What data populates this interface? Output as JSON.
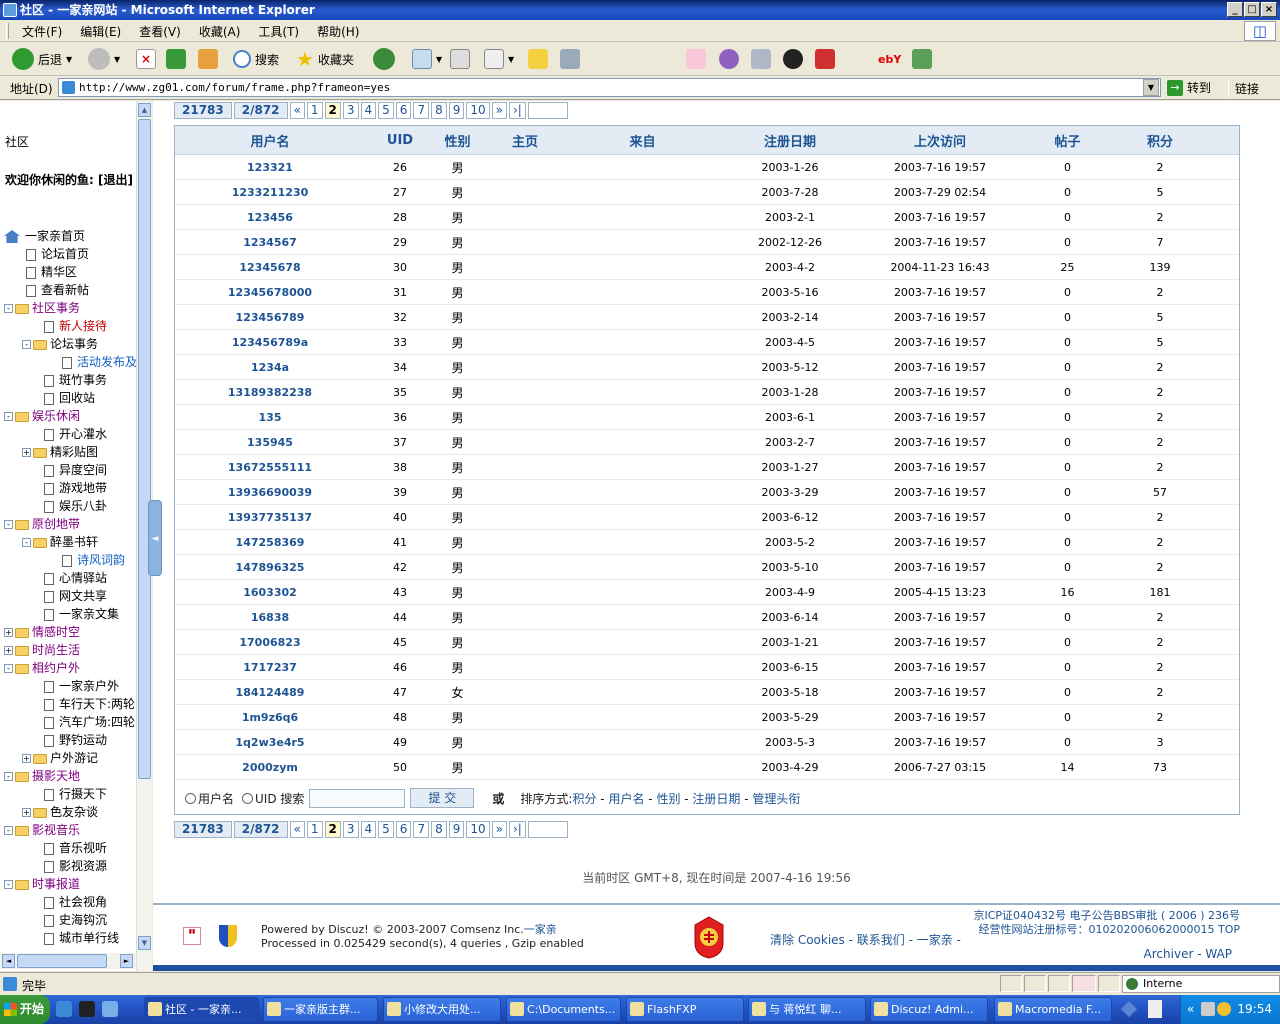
{
  "window": {
    "title": "社区 - 一家亲网站 - Microsoft Internet Explorer"
  },
  "menu": [
    "文件(F)",
    "编辑(E)",
    "查看(V)",
    "收藏(A)",
    "工具(T)",
    "帮助(H)"
  ],
  "toolbar": {
    "back": "后退",
    "search": "搜索",
    "favorites": "收藏夹"
  },
  "address": {
    "label": "地址(D)",
    "url": "http://www.zg01.com/forum/frame.php?frameon=yes",
    "go": "转到",
    "links": "链接"
  },
  "sidebar": {
    "heading": "社区",
    "welcome": "欢迎你休闲的鱼: [退出]",
    "tree": [
      {
        "label": "一家亲首页",
        "indent": 0,
        "type": "home",
        "color": ""
      },
      {
        "label": "论坛首页",
        "indent": 1,
        "type": "doc",
        "color": ""
      },
      {
        "label": "精华区",
        "indent": 1,
        "type": "doc",
        "color": ""
      },
      {
        "label": "查看新帖",
        "indent": 1,
        "type": "doc",
        "color": ""
      },
      {
        "label": "社区事务",
        "indent": 0,
        "type": "folder",
        "pm": "-",
        "color": "purp"
      },
      {
        "label": "新人接待",
        "indent": 2,
        "type": "doc",
        "color": "red"
      },
      {
        "label": "论坛事务",
        "indent": 1,
        "type": "folder",
        "pm": "-",
        "color": ""
      },
      {
        "label": "活动发布及",
        "indent": 3,
        "type": "doc",
        "color": "blue"
      },
      {
        "label": "斑竹事务",
        "indent": 2,
        "type": "doc",
        "color": ""
      },
      {
        "label": "回收站",
        "indent": 2,
        "type": "doc",
        "color": ""
      },
      {
        "label": "娱乐休闲",
        "indent": 0,
        "type": "folder",
        "pm": "-",
        "color": "purp"
      },
      {
        "label": "开心灌水",
        "indent": 2,
        "type": "doc",
        "color": ""
      },
      {
        "label": "精彩贴图",
        "indent": 1,
        "type": "folder",
        "pm": "+",
        "color": ""
      },
      {
        "label": "异度空间",
        "indent": 2,
        "type": "doc",
        "color": ""
      },
      {
        "label": "游戏地带",
        "indent": 2,
        "type": "doc",
        "color": ""
      },
      {
        "label": "娱乐八卦",
        "indent": 2,
        "type": "doc",
        "color": ""
      },
      {
        "label": "原创地带",
        "indent": 0,
        "type": "folder",
        "pm": "-",
        "color": "purp"
      },
      {
        "label": "醉墨书轩",
        "indent": 1,
        "type": "folder",
        "pm": "-",
        "color": ""
      },
      {
        "label": "诗风词韵",
        "indent": 3,
        "type": "doc",
        "color": "blue"
      },
      {
        "label": "心情驿站",
        "indent": 2,
        "type": "doc",
        "color": ""
      },
      {
        "label": "网文共享",
        "indent": 2,
        "type": "doc",
        "color": ""
      },
      {
        "label": "一家亲文集",
        "indent": 2,
        "type": "doc",
        "color": ""
      },
      {
        "label": "情感时空",
        "indent": 0,
        "type": "folder",
        "pm": "+",
        "color": "purp"
      },
      {
        "label": "时尚生活",
        "indent": 0,
        "type": "folder",
        "pm": "+",
        "color": "purp"
      },
      {
        "label": "相约户外",
        "indent": 0,
        "type": "folder",
        "pm": "-",
        "color": "purp"
      },
      {
        "label": "一家亲户外",
        "indent": 2,
        "type": "doc",
        "color": ""
      },
      {
        "label": "车行天下:两轮",
        "indent": 2,
        "type": "doc",
        "color": ""
      },
      {
        "label": "汽车广场:四轮",
        "indent": 2,
        "type": "doc",
        "color": ""
      },
      {
        "label": "野钓运动",
        "indent": 2,
        "type": "doc",
        "color": ""
      },
      {
        "label": "户外游记",
        "indent": 1,
        "type": "folder",
        "pm": "+",
        "color": ""
      },
      {
        "label": "摄影天地",
        "indent": 0,
        "type": "folder",
        "pm": "-",
        "color": "purp"
      },
      {
        "label": "行摄天下",
        "indent": 2,
        "type": "doc",
        "color": ""
      },
      {
        "label": "色友杂谈",
        "indent": 1,
        "type": "folder",
        "pm": "+",
        "color": ""
      },
      {
        "label": "影视音乐",
        "indent": 0,
        "type": "folder",
        "pm": "-",
        "color": "purp"
      },
      {
        "label": "音乐视听",
        "indent": 2,
        "type": "doc",
        "color": ""
      },
      {
        "label": "影视资源",
        "indent": 2,
        "type": "doc",
        "color": ""
      },
      {
        "label": "时事报道",
        "indent": 0,
        "type": "folder",
        "pm": "-",
        "color": "purp"
      },
      {
        "label": "社会视角",
        "indent": 2,
        "type": "doc",
        "color": ""
      },
      {
        "label": "史海钩沉",
        "indent": 2,
        "type": "doc",
        "color": ""
      },
      {
        "label": "城市单行线",
        "indent": 2,
        "type": "doc",
        "color": ""
      }
    ]
  },
  "pager": {
    "total": "21783",
    "pages": "2/872",
    "items": [
      "«",
      "1",
      "2",
      "3",
      "4",
      "5",
      "6",
      "7",
      "8",
      "9",
      "10",
      "»",
      "›|"
    ],
    "current": "2"
  },
  "table": {
    "headers": [
      "用户名",
      "UID",
      "性别",
      "主页",
      "来自",
      "注册日期",
      "上次访问",
      "帖子",
      "积分"
    ],
    "rows": [
      [
        "123321",
        "26",
        "男",
        "",
        "",
        "2003-1-26",
        "2003-7-16 19:57",
        "0",
        "2"
      ],
      [
        "1233211230",
        "27",
        "男",
        "",
        "",
        "2003-7-28",
        "2003-7-29 02:54",
        "0",
        "5"
      ],
      [
        "123456",
        "28",
        "男",
        "",
        "",
        "2003-2-1",
        "2003-7-16 19:57",
        "0",
        "2"
      ],
      [
        "1234567",
        "29",
        "男",
        "",
        "",
        "2002-12-26",
        "2003-7-16 19:57",
        "0",
        "7"
      ],
      [
        "12345678",
        "30",
        "男",
        "",
        "",
        "2003-4-2",
        "2004-11-23 16:43",
        "25",
        "139"
      ],
      [
        "12345678000",
        "31",
        "男",
        "",
        "",
        "2003-5-16",
        "2003-7-16 19:57",
        "0",
        "2"
      ],
      [
        "123456789",
        "32",
        "男",
        "",
        "",
        "2003-2-14",
        "2003-7-16 19:57",
        "0",
        "5"
      ],
      [
        "123456789a",
        "33",
        "男",
        "",
        "",
        "2003-4-5",
        "2003-7-16 19:57",
        "0",
        "5"
      ],
      [
        "1234a",
        "34",
        "男",
        "",
        "",
        "2003-5-12",
        "2003-7-16 19:57",
        "0",
        "2"
      ],
      [
        "13189382238",
        "35",
        "男",
        "",
        "",
        "2003-1-28",
        "2003-7-16 19:57",
        "0",
        "2"
      ],
      [
        "135",
        "36",
        "男",
        "",
        "",
        "2003-6-1",
        "2003-7-16 19:57",
        "0",
        "2"
      ],
      [
        "135945",
        "37",
        "男",
        "",
        "",
        "2003-2-7",
        "2003-7-16 19:57",
        "0",
        "2"
      ],
      [
        "13672555111",
        "38",
        "男",
        "",
        "",
        "2003-1-27",
        "2003-7-16 19:57",
        "0",
        "2"
      ],
      [
        "13936690039",
        "39",
        "男",
        "",
        "",
        "2003-3-29",
        "2003-7-16 19:57",
        "0",
        "57"
      ],
      [
        "13937735137",
        "40",
        "男",
        "",
        "",
        "2003-6-12",
        "2003-7-16 19:57",
        "0",
        "2"
      ],
      [
        "147258369",
        "41",
        "男",
        "",
        "",
        "2003-5-2",
        "2003-7-16 19:57",
        "0",
        "2"
      ],
      [
        "147896325",
        "42",
        "男",
        "",
        "",
        "2003-5-10",
        "2003-7-16 19:57",
        "0",
        "2"
      ],
      [
        "1603302",
        "43",
        "男",
        "",
        "",
        "2003-4-9",
        "2005-4-15 13:23",
        "16",
        "181"
      ],
      [
        "16838",
        "44",
        "男",
        "",
        "",
        "2003-6-14",
        "2003-7-16 19:57",
        "0",
        "2"
      ],
      [
        "17006823",
        "45",
        "男",
        "",
        "",
        "2003-1-21",
        "2003-7-16 19:57",
        "0",
        "2"
      ],
      [
        "1717237",
        "46",
        "男",
        "",
        "",
        "2003-6-15",
        "2003-7-16 19:57",
        "0",
        "2"
      ],
      [
        "184124489",
        "47",
        "女",
        "",
        "",
        "2003-5-18",
        "2003-7-16 19:57",
        "0",
        "2"
      ],
      [
        "1m9z6q6",
        "48",
        "男",
        "",
        "",
        "2003-5-29",
        "2003-7-16 19:57",
        "0",
        "2"
      ],
      [
        "1q2w3e4r5",
        "49",
        "男",
        "",
        "",
        "2003-5-3",
        "2003-7-16 19:57",
        "0",
        "3"
      ],
      [
        "2000zym",
        "50",
        "男",
        "",
        "",
        "2003-4-29",
        "2006-7-27 03:15",
        "14",
        "73"
      ]
    ]
  },
  "search": {
    "opt_username": "用户名",
    "opt_uid": "UID 搜索",
    "submit": "提 交",
    "or": "或",
    "sort_label": "排序方式: ",
    "sort_links": [
      "积分",
      "用户名",
      "性别",
      "注册日期",
      "管理头衔"
    ]
  },
  "timezone": "当前时区 GMT+8, 现在时间是 2007-4-16 19:56",
  "footer": {
    "powered": "Powered by Discuz!  © 2003-2007 Comsenz Inc.",
    "site_link": "一家亲",
    "processed": "Processed in 0.025429 second(s), 4 queries , Gzip enabled",
    "links": "清除 Cookies - 联系我们 - 一家亲 -",
    "icp1": "京ICP证040432号  电子公告BBS审批 ( 2006 ) 236号",
    "icp2": "经营性网站注册标号：010202006062000015   TOP",
    "archiver": "Archiver - WAP"
  },
  "status": {
    "text": "完毕",
    "zone": "Interne"
  },
  "taskbar": {
    "start": "开始",
    "tasks": [
      "社区 - 一家亲...",
      "一家亲版主群...",
      "小修改大用处...",
      "C:\\Documents...",
      "FlashFXP",
      "与 蒋悦红 聊...",
      "Discuz! Admi...",
      "Macromedia F..."
    ],
    "clock": "19:54"
  }
}
